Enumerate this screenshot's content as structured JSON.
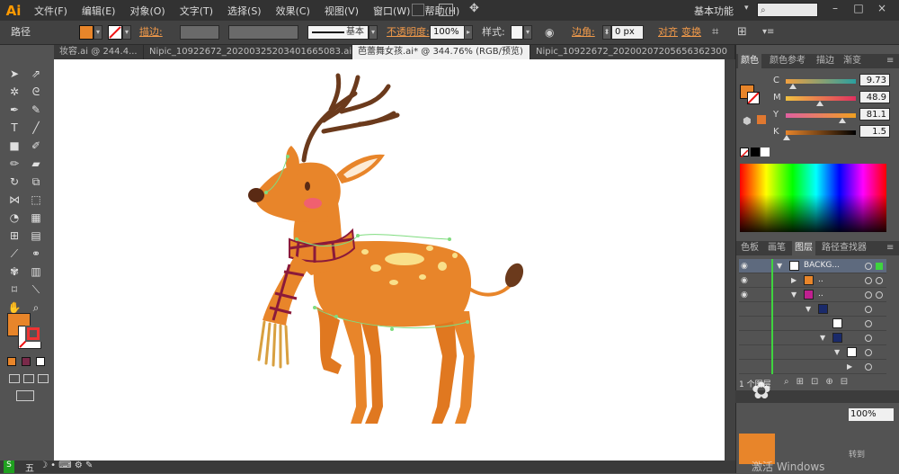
{
  "menubar": {
    "logo": "Ai",
    "items": [
      "文件(F)",
      "编辑(E)",
      "对象(O)",
      "文字(T)",
      "选择(S)",
      "效果(C)",
      "视图(V)",
      "窗口(W)",
      "帮助(H)"
    ],
    "workspace": "基本功能",
    "window_buttons": [
      "–",
      "□",
      "×"
    ]
  },
  "controlbar": {
    "object_type": "路径",
    "fill_color": "#e8852a",
    "stroke_label": "描边:",
    "stroke_style": "基本",
    "opacity_label": "不透明度:",
    "opacity_value": "100%",
    "style_label": "样式:",
    "corner_label": "边角:",
    "corner_value": "0 px",
    "align_label": "对齐",
    "transform_label": "变换"
  },
  "tabs": [
    {
      "label": "妆容.ai @ 244.4..."
    },
    {
      "label": "Nipic_10922672_20200325203401665083.ai*"
    },
    {
      "label": "芭蕾舞女孩.ai* @ 344.76% (RGB/预览)",
      "active": true
    },
    {
      "label": "Nipic_10922672_20200207205656362300"
    }
  ],
  "color_panel": {
    "tabs": [
      "颜色",
      "颜色参考",
      "描边",
      "渐变"
    ],
    "fill": "#e8852a",
    "channels": [
      {
        "label": "C",
        "value": "9.73",
        "fraction": 0.0973
      },
      {
        "label": "M",
        "value": "48.9",
        "fraction": 0.489
      },
      {
        "label": "Y",
        "value": "81.1",
        "fraction": 0.811
      },
      {
        "label": "K",
        "value": "1.5",
        "fraction": 0.015
      }
    ]
  },
  "layers_panel": {
    "tabs": [
      "色板",
      "画笔",
      "图层",
      "路径查找器"
    ],
    "top_layer": "BACKG...",
    "sub_label": "..",
    "count_label": "1 个图层"
  },
  "status": {
    "zoom": "100%",
    "watermark_lines": [
      "激活 Windows",
      "转到"
    ],
    "ime": "五"
  }
}
